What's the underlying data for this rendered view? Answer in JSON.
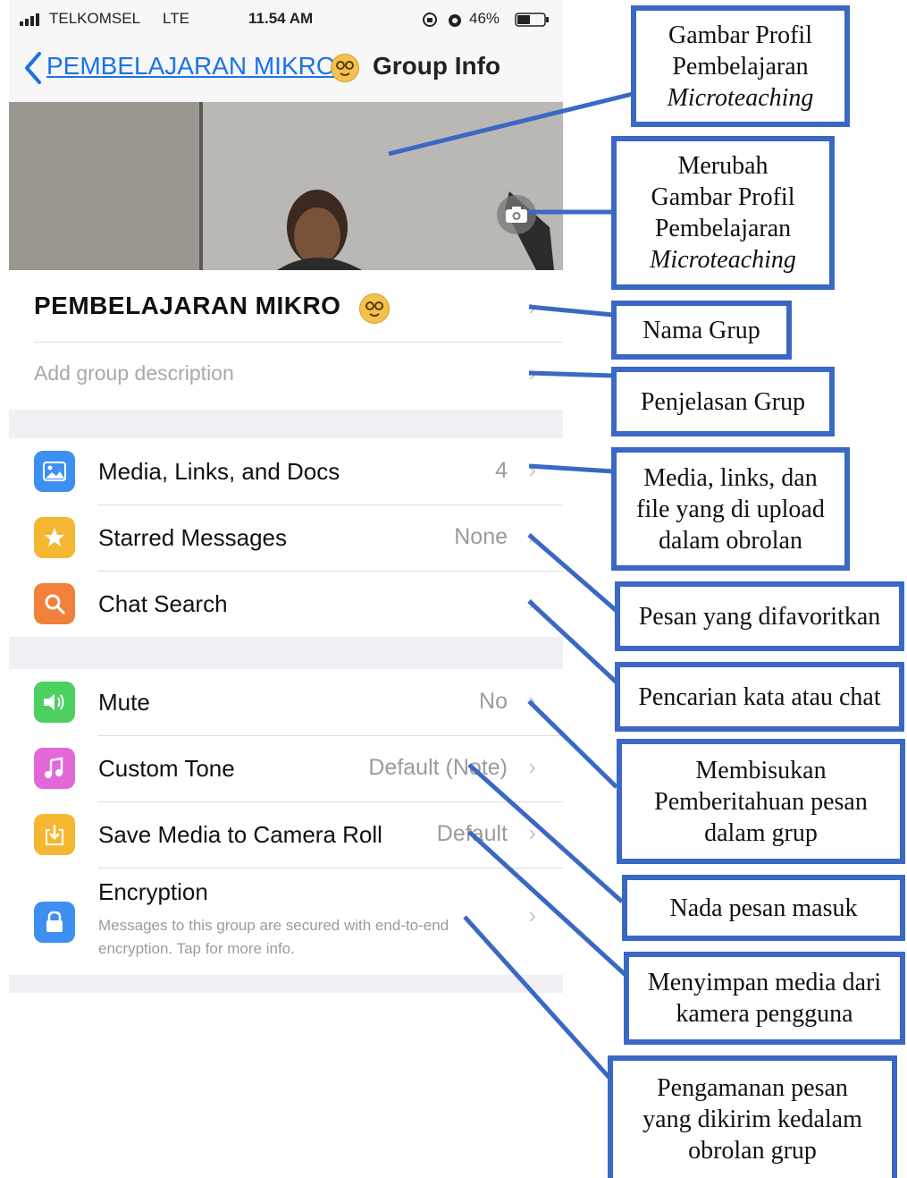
{
  "status_bar": {
    "carrier": "TELKOMSEL",
    "network": "LTE",
    "time": "11.54 AM",
    "battery": "46%"
  },
  "nav": {
    "back_label": "PEMBELAJARAN MIKRO",
    "title": "Group Info"
  },
  "group": {
    "name": "PEMBELAJARAN MIKRO",
    "description_placeholder": "Add group description"
  },
  "menu_section_1": [
    {
      "label": "Media, Links, and Docs",
      "value": "4",
      "icon": "photo-icon",
      "color": "#3d8ff2"
    },
    {
      "label": "Starred Messages",
      "value": "None",
      "icon": "star-icon",
      "color": "#f5b731"
    },
    {
      "label": "Chat Search",
      "value": "",
      "icon": "search-icon",
      "color": "#f0803a"
    }
  ],
  "menu_section_2": [
    {
      "label": "Mute",
      "value": "No",
      "icon": "speaker-icon",
      "color": "#4cd060"
    },
    {
      "label": "Custom Tone",
      "value": "Default (Note)",
      "icon": "music-note-icon",
      "color": "#e267d8"
    },
    {
      "label": "Save Media to Camera Roll",
      "value": "Default",
      "icon": "download-icon",
      "color": "#f5b731"
    }
  ],
  "encryption": {
    "label": "Encryption",
    "description": "Messages to this group are secured with end-to-end encryption. Tap for more info.",
    "icon": "lock-icon",
    "color": "#3d8ff2"
  },
  "annotations": {
    "profile_picture": [
      "Gambar Profil",
      "Pembelajaran",
      "Microteaching"
    ],
    "change_profile_picture": [
      "Merubah",
      "Gambar Profil",
      "Pembelajaran",
      "Microteaching"
    ],
    "group_name": "Nama Grup",
    "group_description": "Penjelasan Grup",
    "media": [
      "Media, links, dan",
      "file yang di upload",
      "dalam obrolan"
    ],
    "starred": "Pesan yang difavoritkan",
    "search": "Pencarian kata atau chat",
    "mute": [
      "Membisukan",
      "Pemberitahuan pesan",
      "dalam grup"
    ],
    "tone": "Nada pesan masuk",
    "save_media": [
      "Menyimpan media dari",
      "kamera pengguna"
    ],
    "encryption": [
      "Pengamanan pesan",
      "yang dikirim kedalam",
      "obrolan grup"
    ]
  },
  "colors": {
    "annotation_border": "#3a68c4",
    "link_blue": "#1a73e8"
  }
}
